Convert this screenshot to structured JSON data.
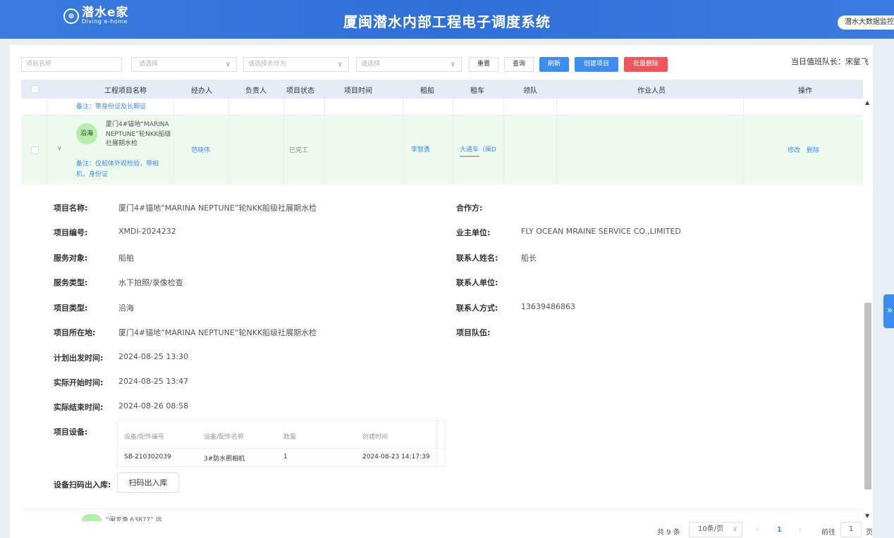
{
  "header": {
    "logo_mark": "⊕",
    "logo_cn": "潜水e家",
    "logo_en": "Diving e-home",
    "title": "厦闽潜水内部工程电子调度系统",
    "monitor_button": "潜水大数据监控"
  },
  "filters": {
    "project_name_placeholder": "项目名称",
    "select1_placeholder": "请选择",
    "partner_placeholder": "请选择合作方",
    "select3_placeholder": "请选择",
    "reset": "重置",
    "query": "查询",
    "refresh": "刷新",
    "create": "创建项目",
    "batch_delete": "批量删除"
  },
  "duty": "当日值班队长：宋星飞",
  "table": {
    "columns": [
      "工程项目名称",
      "经办人",
      "负责人",
      "项目状态",
      "项目时间",
      "租船",
      "租车",
      "领队",
      "作业人员",
      "操作"
    ],
    "prev_row_note": "备注：带身份证及长期证",
    "row": {
      "badge": "沿海",
      "name": "厦门4#锚地“MARINA NEPTUNE”轮NKK船级社展期水检",
      "note": "备注：仅船体外观检验，带相机，身份证",
      "handler": "范晓伟",
      "status": "已完工",
      "boat": "李智勇",
      "car": "大通车（闽D",
      "edit": "修改",
      "delete": "删除"
    },
    "next_row_partial": "“闽龙渔 63877” 远"
  },
  "detail": {
    "left": [
      {
        "label": "项目名称:",
        "value": "厦门4#锚地“MARINA NEPTUNE”轮NKK船级社展期水检"
      },
      {
        "label": "项目编号:",
        "value": "XMDI-2024232"
      },
      {
        "label": "服务对象:",
        "value": "船舶"
      },
      {
        "label": "服务类型:",
        "value": "水下拍照/录像检查"
      },
      {
        "label": "项目类型:",
        "value": "沿海"
      },
      {
        "label": "项目所在地:",
        "value": "厦门4#锚地“MARINA NEPTUNE”轮NKK船级社展期水检"
      },
      {
        "label": "计划出发时间:",
        "value": "2024-08-25 13:30"
      },
      {
        "label": "实际开始时间:",
        "value": "2024-08-25 13:47"
      },
      {
        "label": "实际结束时间:",
        "value": "2024-08-26 08:58"
      }
    ],
    "right": [
      {
        "label": "合作方:",
        "value": ""
      },
      {
        "label": "业主单位:",
        "value": "FLY OCEAN MRAINE SERVICE CO.,LIMITED"
      },
      {
        "label": "联系人姓名:",
        "value": "船长"
      },
      {
        "label": "联系人单位:",
        "value": ""
      },
      {
        "label": "联系人方式:",
        "value": "13639486863"
      },
      {
        "label": "项目队伍:",
        "value": ""
      }
    ],
    "equipment_label": "项目设备:",
    "equipment_columns": [
      "设备/配件编号",
      "设备/配件名称",
      "数量",
      "创建时间"
    ],
    "equipment_rows": [
      {
        "code": "SB-210302039",
        "name": "3#防水照相机",
        "qty": "1",
        "created": "2024-08-23 14:17:39"
      }
    ],
    "scan_label": "设备扫码出入库:",
    "scan_button": "扫码出入库"
  },
  "pager": {
    "total": "共 9 条",
    "page_size": "10条/页",
    "current": "1",
    "goto_label": "前往",
    "goto_value": "1",
    "page_suffix": "页"
  }
}
